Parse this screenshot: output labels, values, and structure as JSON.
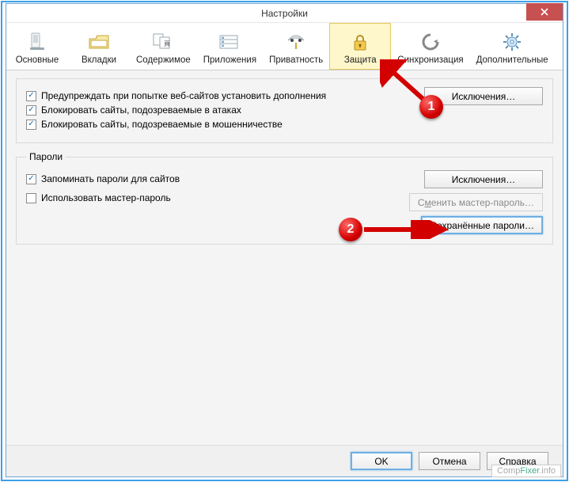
{
  "window": {
    "title": "Настройки"
  },
  "toolbar": {
    "items": [
      {
        "label": "Основные"
      },
      {
        "label": "Вкладки"
      },
      {
        "label": "Содержимое"
      },
      {
        "label": "Приложения"
      },
      {
        "label": "Приватность"
      },
      {
        "label": "Защита"
      },
      {
        "label": "Синхронизация"
      },
      {
        "label": "Дополнительные"
      }
    ]
  },
  "group1": {
    "chk_addons": "Предупреждать при попытке веб-сайтов установить дополнения",
    "chk_attack": "Блокировать сайты, подозреваемые в атаках",
    "chk_fraud": "Блокировать сайты, подозреваемые в мошенничестве",
    "exceptions": "Исключения…"
  },
  "group2": {
    "legend": "Пароли",
    "chk_remember": "Запоминать пароли для сайтов",
    "chk_master": "Использовать мастер-пароль",
    "exceptions": "Исключения…",
    "change_master": "Сменить мастер-пароль…",
    "saved": "Сохранённые пароли…"
  },
  "footer": {
    "ok": "OK",
    "cancel": "Отмена",
    "help": "Справка"
  },
  "annot": {
    "b1": "1",
    "b2": "2"
  },
  "watermark": {
    "a": "Comp",
    "b": "Fixer",
    "c": ".info"
  }
}
